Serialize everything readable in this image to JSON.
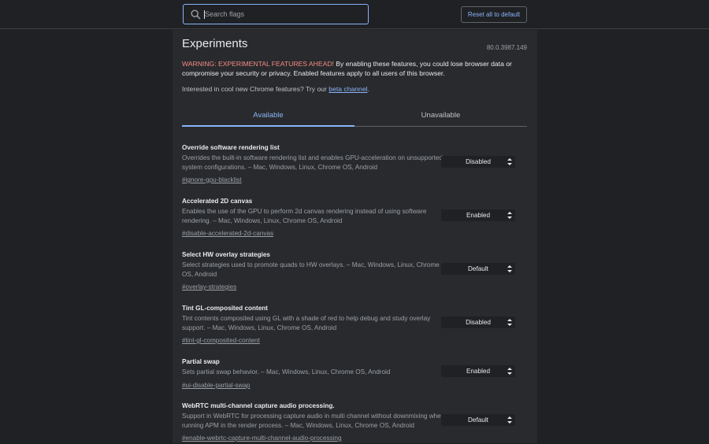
{
  "search": {
    "placeholder": "Search flags"
  },
  "header": {
    "reset_label": "Reset all to default"
  },
  "page": {
    "title": "Experiments",
    "version": "80.0.3987.149",
    "warning_head": "WARNING: EXPERIMENTAL FEATURES AHEAD!",
    "warning_body": " By enabling these features, you could lose browser data or compromise your security or privacy. Enabled features apply to all users of this browser.",
    "promo_text": "Interested in cool new Chrome features? Try our ",
    "promo_link": "beta channel",
    "promo_end": "."
  },
  "tabs": [
    {
      "label": "Available",
      "selected": true
    },
    {
      "label": "Unavailable",
      "selected": false
    }
  ],
  "experiments": [
    {
      "name": "Override software rendering list",
      "description": "Overrides the built-in software rendering list and enables GPU-acceleration on unsupported system configurations. – Mac, Windows, Linux, Chrome OS, Android",
      "link": "#ignore-gpu-blacklist",
      "value": "Disabled"
    },
    {
      "name": "Accelerated 2D canvas",
      "description": "Enables the use of the GPU to perform 2d canvas rendering instead of using software rendering. – Mac, Windows, Linux, Chrome OS, Android",
      "link": "#disable-accelerated-2d-canvas",
      "value": "Enabled"
    },
    {
      "name": "Select HW overlay strategies",
      "description": "Select strategies used to promote quads to HW overlays. – Mac, Windows, Linux, Chrome OS, Android",
      "link": "#overlay-strategies",
      "value": "Default"
    },
    {
      "name": "Tint GL-composited content",
      "description": "Tint contents composited using GL with a shade of red to help debug and study overlay support. – Mac, Windows, Linux, Chrome OS, Android",
      "link": "#tint-gl-composited-content",
      "value": "Disabled"
    },
    {
      "name": "Partial swap",
      "description": "Sets partial swap behavior. – Mac, Windows, Linux, Chrome OS, Android",
      "link": "#ui-disable-partial-swap",
      "value": "Enabled"
    },
    {
      "name": "WebRTC multi-channel capture audio processing.",
      "description": "Support in WebRTC for processing capture audio in multi channel without downmixing when running APM in the render process. – Mac, Windows, Linux, Chrome OS, Android",
      "link": "#enable-webrtc-capture-multi-channel-audio-processing",
      "value": "Default"
    }
  ],
  "colors": {
    "background": "#202124",
    "panel": "#292a2d",
    "accent": "#8ab4f8",
    "warning": "#f28b82"
  }
}
